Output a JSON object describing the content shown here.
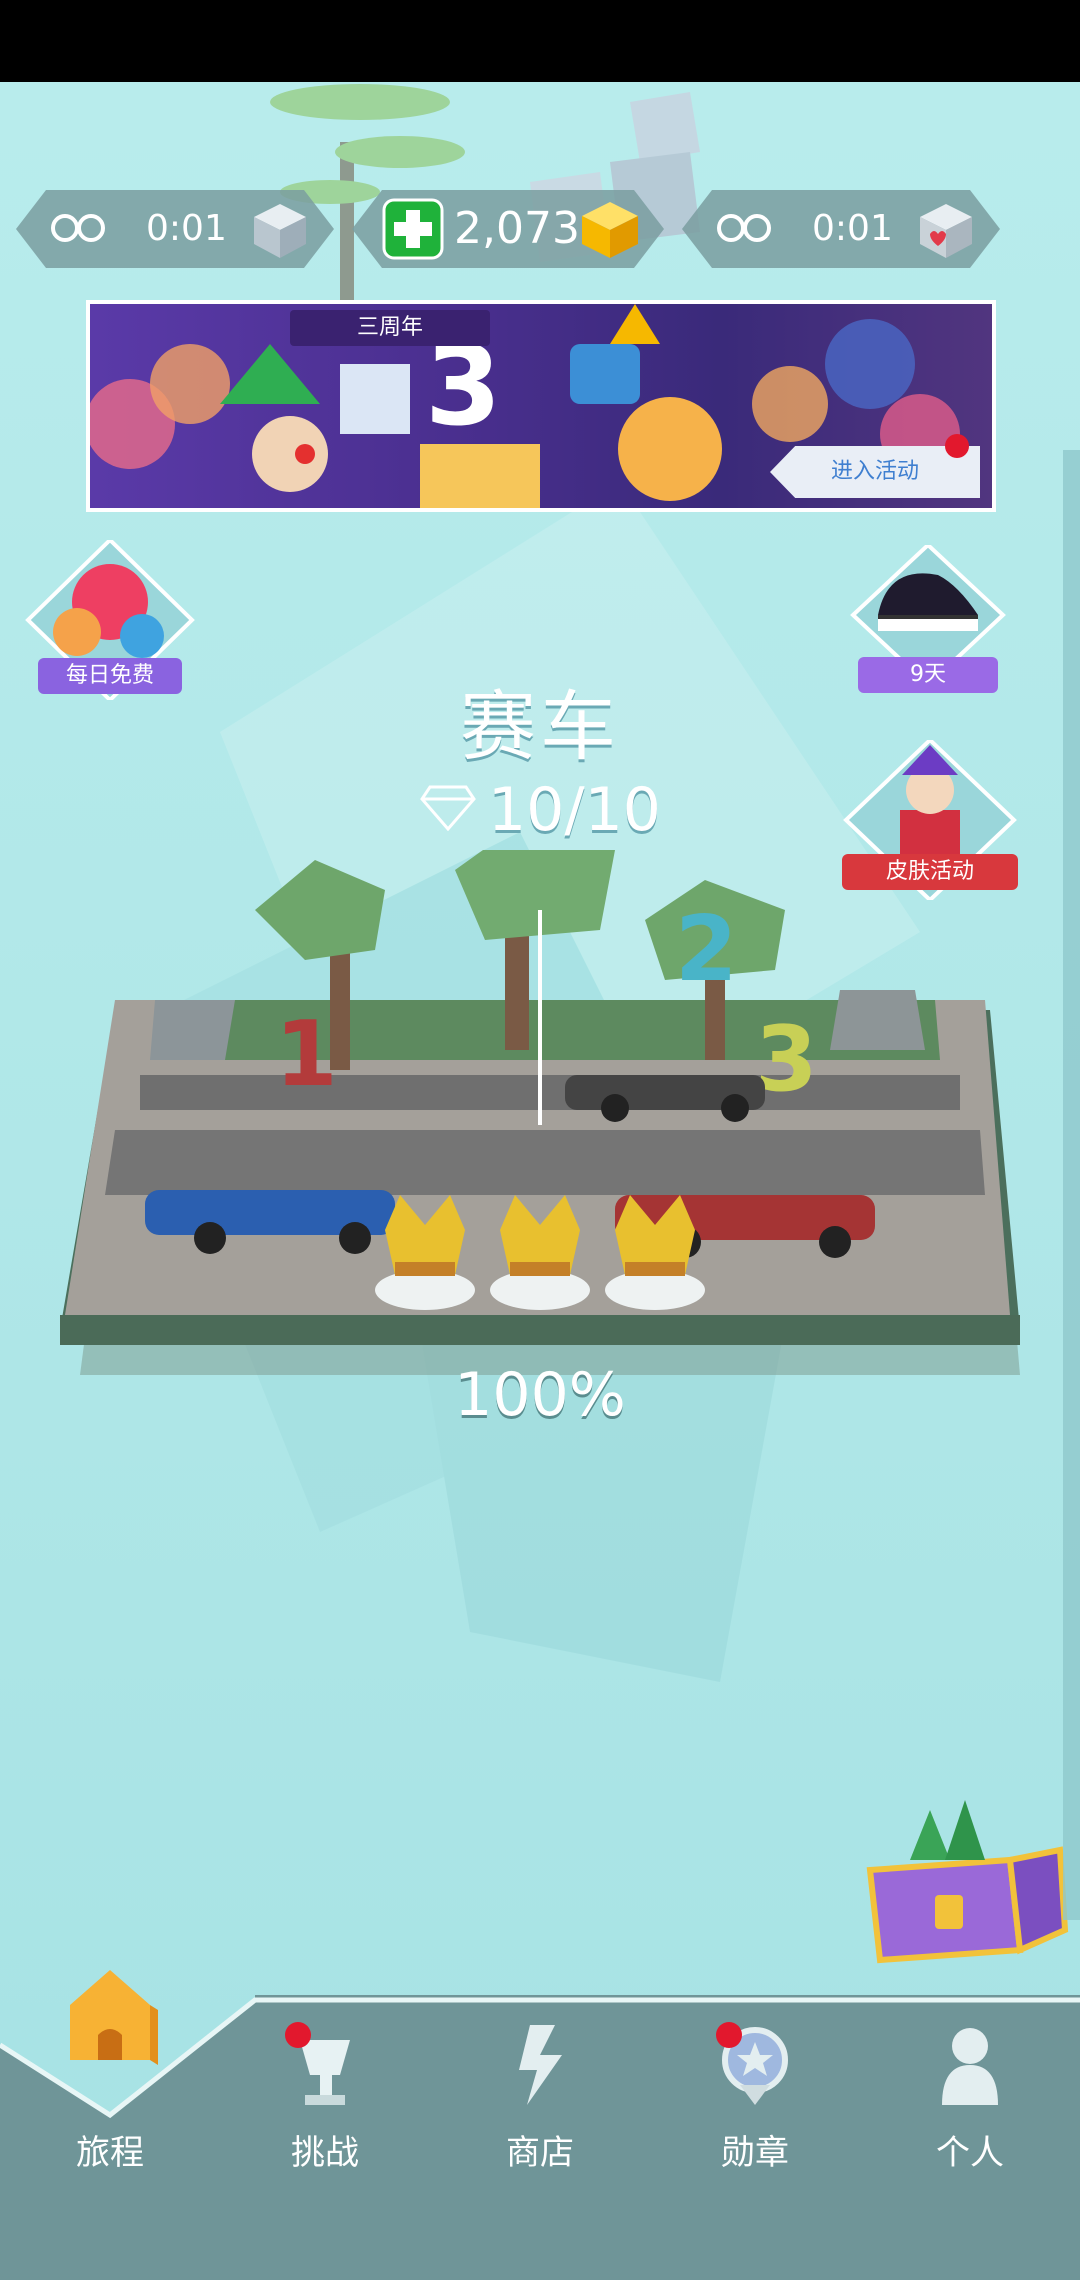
{
  "resources": {
    "left_timer": "0:01",
    "coins": "2,073",
    "right_timer": "0:01"
  },
  "banner": {
    "tag": "三周年",
    "number": "3",
    "cta": "进入活动"
  },
  "side": {
    "daily_free": "每日免费",
    "piano_days": "9天",
    "skin_event": "皮肤活动"
  },
  "level": {
    "title": "赛车",
    "gems": "10/10",
    "progress": "100%"
  },
  "scene": {
    "podium_numbers": [
      "1",
      "2",
      "3"
    ]
  },
  "nav": {
    "items": [
      {
        "label": "旅程",
        "icon": "house-icon",
        "active": true
      },
      {
        "label": "挑战",
        "icon": "trophy-icon",
        "badge": true
      },
      {
        "label": "商店",
        "icon": "shop-icon"
      },
      {
        "label": "勋章",
        "icon": "medal-icon",
        "badge": true
      },
      {
        "label": "个人",
        "icon": "profile-icon"
      }
    ]
  },
  "colors": {
    "background": "#aee6e8",
    "gold": "#f6b800",
    "green": "#1fb23a",
    "badge_red": "#e2182d",
    "nav": "#6f9598"
  }
}
